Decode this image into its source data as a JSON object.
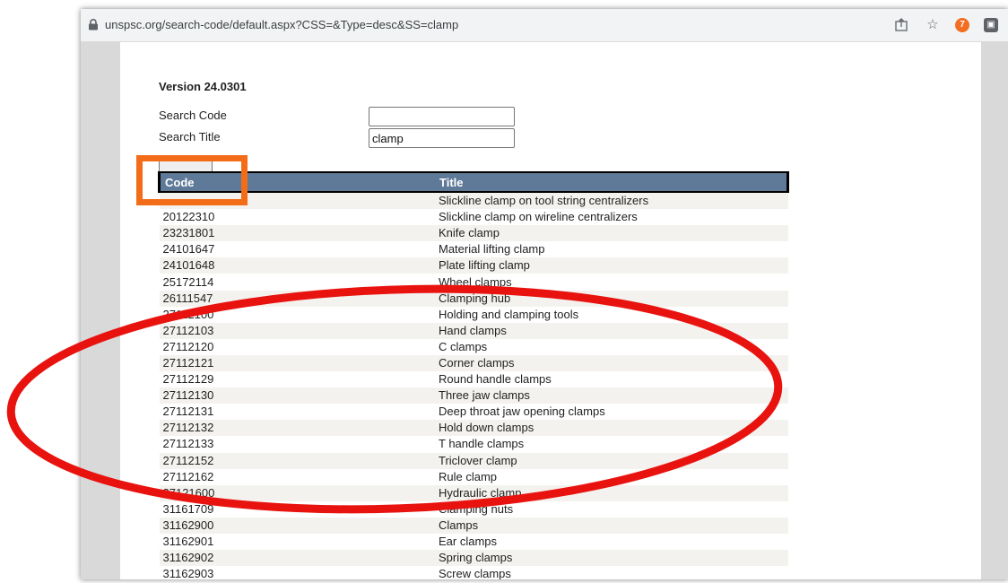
{
  "browser": {
    "url": "unspsc.org/search-code/default.aspx?CSS=&Type=desc&SS=clamp",
    "icons": [
      "lock-icon",
      "share-icon",
      "star-icon",
      "extension-orange-icon",
      "extension-gray-icon"
    ]
  },
  "page": {
    "version": "Version 24.0301",
    "search_code_label": "Search Code",
    "search_code_value": "",
    "search_title_label": "Search Title",
    "search_title_value": "clamp",
    "table": {
      "headers": [
        "Code",
        "Title"
      ],
      "rows": [
        [
          "",
          "Slickline clamp on tool string centralizers"
        ],
        [
          "20122310",
          "Slickline clamp on wireline centralizers"
        ],
        [
          "23231801",
          "Knife clamp"
        ],
        [
          "24101647",
          "Material lifting clamp"
        ],
        [
          "24101648",
          "Plate lifting clamp"
        ],
        [
          "25172114",
          "Wheel clamps"
        ],
        [
          "26111547",
          "Clamping hub"
        ],
        [
          "27112100",
          "Holding and clamping tools"
        ],
        [
          "27112103",
          "Hand clamps"
        ],
        [
          "27112120",
          "C clamps"
        ],
        [
          "27112121",
          "Corner clamps"
        ],
        [
          "27112129",
          "Round handle clamps"
        ],
        [
          "27112130",
          "Three jaw clamps"
        ],
        [
          "27112131",
          "Deep throat jaw opening clamps"
        ],
        [
          "27112132",
          "Hold down clamps"
        ],
        [
          "27112133",
          "T handle clamps"
        ],
        [
          "27112152",
          "Triclover clamp"
        ],
        [
          "27112162",
          "Rule clamp"
        ],
        [
          "27121600",
          "Hydraulic clamp"
        ],
        [
          "31161709",
          "Clamping nuts"
        ],
        [
          "31162900",
          "Clamps"
        ],
        [
          "31162901",
          "Ear clamps"
        ],
        [
          "31162902",
          "Spring clamps"
        ],
        [
          "31162903",
          "Screw clamps"
        ]
      ]
    }
  },
  "annotations": {
    "highlight_rect_color": "#f36c17",
    "ellipse_color": "#e8130f"
  }
}
